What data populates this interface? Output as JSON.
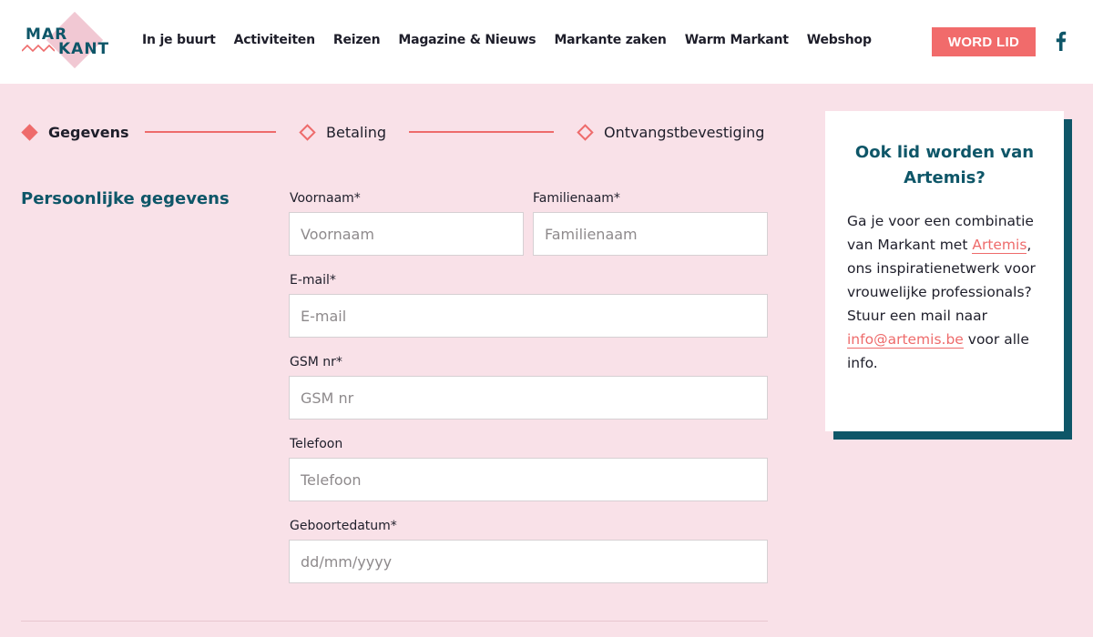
{
  "header": {
    "logo": {
      "line1": "MAR",
      "line2": "KANT"
    },
    "nav": [
      "In je buurt",
      "Activiteiten",
      "Reizen",
      "Magazine & Nieuws",
      "Markante zaken",
      "Warm Markant",
      "Webshop"
    ],
    "cta_label": "WORD LID",
    "social_icon": "facebook-icon"
  },
  "steps": [
    {
      "label": "Gegevens",
      "state": "active"
    },
    {
      "label": "Betaling",
      "state": "inactive"
    },
    {
      "label": "Ontvangstbevestiging",
      "state": "inactive"
    }
  ],
  "section": {
    "title": "Persoonlijke gegevens",
    "fields": {
      "voornaam": {
        "label": "Voornaam*",
        "placeholder": "Voornaam",
        "value": ""
      },
      "familienaam": {
        "label": "Familienaam*",
        "placeholder": "Familienaam",
        "value": ""
      },
      "email": {
        "label": "E-mail*",
        "placeholder": "E-mail",
        "value": ""
      },
      "gsm": {
        "label": "GSM nr*",
        "placeholder": "GSM nr",
        "value": ""
      },
      "telefoon": {
        "label": "Telefoon",
        "placeholder": "Telefoon",
        "value": ""
      },
      "geboortedatum": {
        "label": "Geboortedatum*",
        "placeholder": "dd/mm/yyyy",
        "value": ""
      }
    }
  },
  "info_card": {
    "title": "Ook lid worden van Artemis?",
    "text_before_link": "Ga je voor een combinatie van Markant met ",
    "link1": "Artemis",
    "text_middle": ", ons inspiratienetwerk voor vrouwelijke professionals? Stuur een mail naar ",
    "link2": "info@artemis.be",
    "text_after": " voor alle info."
  },
  "colors": {
    "accent": "#ee6b6b",
    "brand_teal": "#0e5668",
    "background": "#f9e1e8",
    "logo_pink": "#f1c8d3"
  }
}
